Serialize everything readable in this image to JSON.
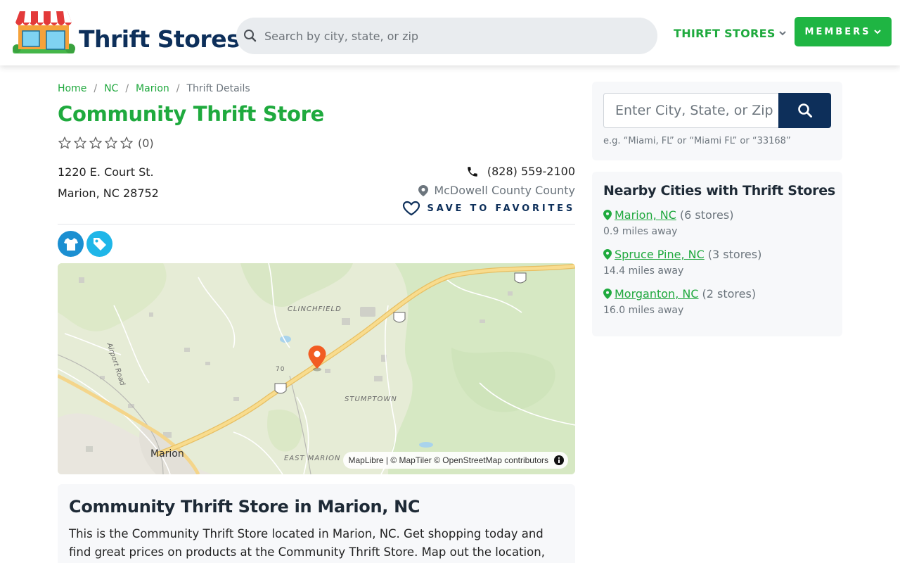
{
  "header": {
    "brand": "Thrift Stores",
    "search_placeholder": "Search by city, state, or zip",
    "nav_stores_label": "THIRFT STORES",
    "members_label": "MEMBERS"
  },
  "breadcrumb": {
    "items": [
      "Home",
      "NC",
      "Marion"
    ],
    "current": "Thrift Details"
  },
  "store": {
    "name": "Community Thrift Store",
    "rating_count": "(0)",
    "address_line1": "1220 E. Court St.",
    "address_line2": "Marion, NC 28752",
    "phone": "(828) 559-2100",
    "county": "McDowell County County",
    "favorites_label": "SAVE TO FAVORITES"
  },
  "map": {
    "labels": [
      "CLINCHFIELD",
      "STUMPTOWN",
      "EAST MARION"
    ],
    "town": "Marion",
    "road": "Airport Road",
    "route_shield": "70",
    "attribution": "MapLibre | © MapTiler © OpenStreetMap contributors"
  },
  "description": {
    "title": "Community Thrift Store in Marion, NC",
    "text": "This is the Community Thrift Store located in Marion, NC. Get shopping today and find great prices on products at the Community Thrift Store. Map out the location, view"
  },
  "sidebar": {
    "search_placeholder": "Enter City, State, or Zip",
    "hint": "e.g. “Miami, FL” or “Miami FL” or “33168”",
    "nearby_title": "Nearby Cities with Thrift Stores",
    "nearby": [
      {
        "city": "Marion, NC",
        "count": "(6 stores)",
        "distance": "0.9 miles away"
      },
      {
        "city": "Spruce Pine, NC",
        "count": "(3 stores)",
        "distance": "14.4 miles away"
      },
      {
        "city": "Morganton, NC",
        "count": "(2 stores)",
        "distance": "16.0 miles away"
      }
    ]
  },
  "colors": {
    "brand_green": "#1faa3e",
    "navy": "#0d2f5a",
    "pin_orange": "#f25c22"
  }
}
